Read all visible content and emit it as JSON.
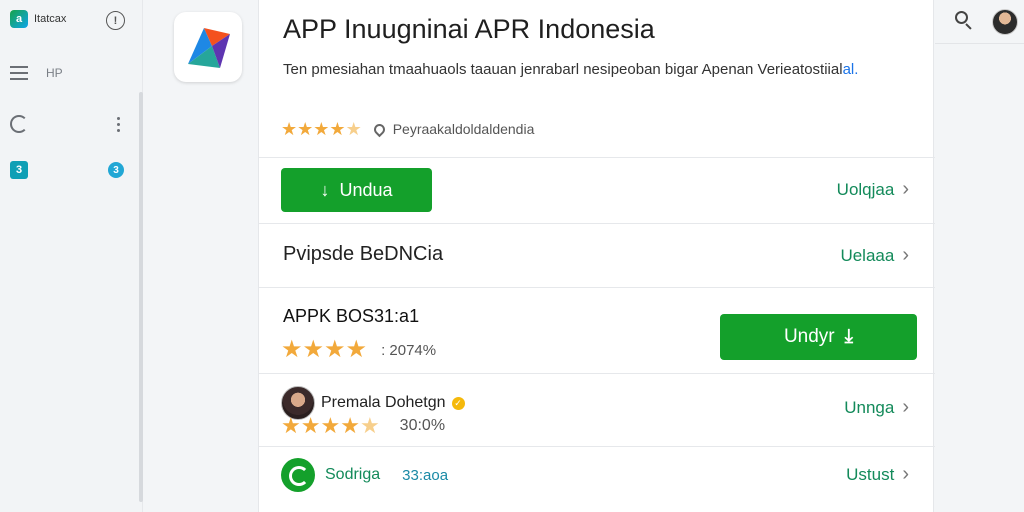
{
  "sidebar": {
    "brand": "Itatcax",
    "menu_label": "HP",
    "app_badge": "3"
  },
  "header": {
    "title": "APP Inuugninai APR Indonesia",
    "description_main": "Ten pmesiahan tmaahuaols taauan jenrabarl nesipeoban bigar Apenan Verieatostiial",
    "description_link": "al.",
    "rating_stars": 4.5,
    "publisher": "Peyraakaldoldaldendia"
  },
  "rows": {
    "download_label": "Undua",
    "row1_link": "Uolqjaa",
    "row2_title": "Pvipsde BeDNCia",
    "row2_link": "Uelaaa"
  },
  "section": {
    "title": "APPK BOS31:a1",
    "rating_stars": 4,
    "rating_meta": ": 2074%",
    "download_label": "Undyr"
  },
  "review": {
    "name": "Premala Dohetgn",
    "rating_stars": 4.5,
    "meta": "30:0%",
    "link": "Unnga"
  },
  "bottom": {
    "label": "Sodriga",
    "meta": "33:aoa",
    "link": "Ustust"
  },
  "colors": {
    "primary_green": "#14a02b",
    "link_green": "#138a5a",
    "star": "#f2a93b"
  }
}
